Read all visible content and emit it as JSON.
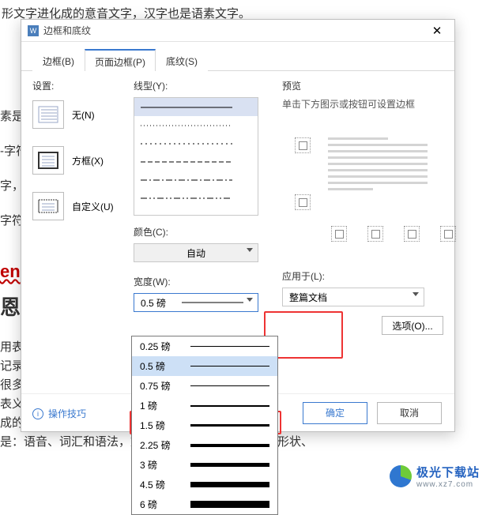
{
  "bg": {
    "l1": "形文字进化成的意音文字，汉字也是语素文字。",
    "l2": "素是",
    "l3": "-字符",
    "l4": "字，",
    "l5": "字符",
    "l6": "en",
    "l7": "恩",
    "l8": "用表",
    "l9": "记录",
    "l10": "很多",
    "l11": "表义",
    "l12": "成的意音文字，汉字也是语素文字。",
    "l13": "是：语音、词汇和语法，文",
    "l14": "符形状、"
  },
  "modal": {
    "title": "边框和底纹",
    "tabs": {
      "t1": "边框(B)",
      "t2": "页面边框(P)",
      "t3": "底纹(S)"
    },
    "settings": {
      "label": "设置:",
      "none": "无(N)",
      "box": "方框(X)",
      "custom": "自定义(U)"
    },
    "style": {
      "label": "线型(Y):"
    },
    "color": {
      "label": "颜色(C):",
      "value": "自动"
    },
    "width": {
      "label": "宽度(W):",
      "value": "0.5  磅"
    },
    "preview": {
      "label": "预览",
      "hint": "单击下方图示或按钮可设置边框"
    },
    "apply": {
      "label": "应用于(L):",
      "value": "整篇文档"
    },
    "options": "选项(O)...",
    "tips": "操作技巧",
    "ok": "确定",
    "cancel": "取消"
  },
  "drop": {
    "options": [
      {
        "label": "0.25 磅",
        "w": 0.5
      },
      {
        "label": "0.5  磅",
        "w": 1,
        "sel": true
      },
      {
        "label": "0.75 磅",
        "w": 1.5
      },
      {
        "label": "1     磅",
        "w": 2
      },
      {
        "label": "1.5  磅",
        "w": 3,
        "hl": true
      },
      {
        "label": "2.25 磅",
        "w": 4
      },
      {
        "label": "3     磅",
        "w": 5
      },
      {
        "label": "4.5  磅",
        "w": 7
      },
      {
        "label": "6     磅",
        "w": 9
      }
    ]
  },
  "logo": {
    "t1": "极光下载站",
    "t2": "www.xz7.com"
  }
}
